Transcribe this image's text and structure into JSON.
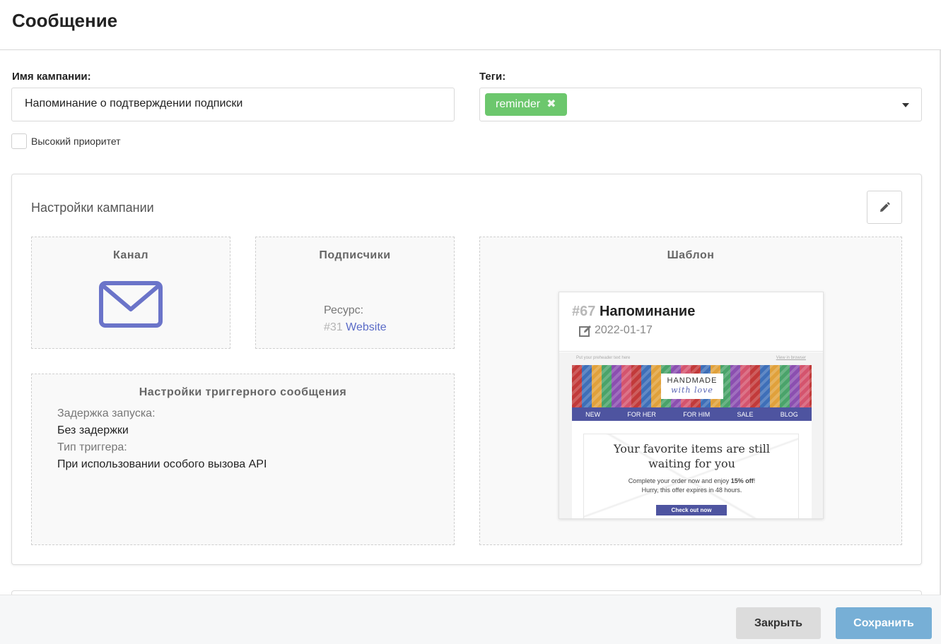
{
  "header": {
    "title": "Сообщение"
  },
  "form": {
    "campaign_name_label": "Имя кампании:",
    "campaign_name_value": "Напоминание о подтверждении подписки",
    "tags_label": "Теги:",
    "tags": [
      {
        "label": "reminder",
        "remove_icon": "✖"
      }
    ],
    "priority_label": "Высокий приоритет",
    "priority_checked": false
  },
  "settings": {
    "title": "Настройки кампании",
    "channel": {
      "title": "Канал",
      "icon": "envelope-icon",
      "icon_color": "#6b74c9"
    },
    "subscribers": {
      "title": "Подписчики",
      "resource_label": "Ресурс:",
      "resource_id": "#31",
      "resource_name": "Website"
    },
    "trigger": {
      "title": "Настройки триггерного сообщения",
      "delay_label": "Задержка запуска:",
      "delay_value": "Без задержки",
      "type_label": "Тип триггера:",
      "type_value": "При использовании особого вызова API"
    },
    "template": {
      "title": "Шаблон",
      "id": "#67",
      "name": "Напоминание",
      "date": "2022-01-17",
      "preview": {
        "preheader": "Put your preheader text here",
        "view_in_browser": "View in browser",
        "logo_top": "HANDMADE",
        "logo_bottom": "with love",
        "nav": [
          "NEW",
          "FOR HER",
          "FOR HIM",
          "SALE",
          "BLOG"
        ],
        "headline_1": "Your favorite items are still",
        "headline_2": "waiting for you",
        "body_1_a": "Complete your order now and enjoy ",
        "body_1_b": "15% off",
        "body_1_c": "!",
        "body_2": "Hurry, this offer expires in 48 hours.",
        "cta": "Check out now"
      }
    }
  },
  "footer": {
    "close_label": "Закрыть",
    "save_label": "Сохранить"
  },
  "colors": {
    "accent": "#5a6bc7",
    "tag": "#6cc76d",
    "save": "#77afd6",
    "close": "#dcdcdc"
  }
}
